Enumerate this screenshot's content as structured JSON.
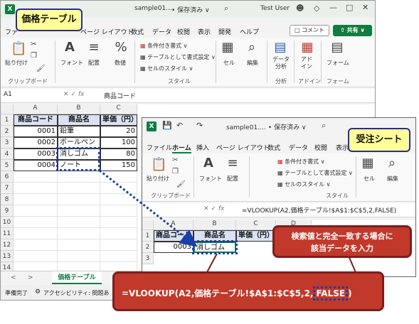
{
  "back_window": {
    "app_letter": "X",
    "file_name": "sample01.…",
    "save_status": "• 保存済み ∨",
    "search_icon": "⌕",
    "user": "Test User",
    "menu": [
      "ファ",
      "ページ レイアウト",
      "数式",
      "データ",
      "校閲",
      "表示",
      "開発",
      "ヘルプ"
    ],
    "comment_btn": "コメント",
    "share_btn": "共有",
    "ribbon": {
      "paste": "貼り付け",
      "font": "フォント",
      "align": "配置",
      "number": "数値",
      "cond_format": "条件付き書式 ∨",
      "table_format": "テーブルとして書式設定 ∨",
      "cell_style": "セルのスタイル ∨",
      "style_group": "スタイル",
      "cells": "セル",
      "edit": "編集",
      "data_analysis": "データ\n分析",
      "addin": "アド\nイン",
      "form": "フォーム",
      "clipboard_group": "クリップボード",
      "analysis_group": "分析",
      "addin_group": "アドイン",
      "form_group": "フォーム"
    },
    "name_box": "A1",
    "formula": "商品コード",
    "col_headers": [
      "A",
      "B",
      "C"
    ],
    "row_headers": [
      "1",
      "2",
      "3",
      "4",
      "5",
      "6",
      "7",
      "8",
      "9",
      "10",
      "11",
      "12",
      "13",
      "14",
      "15"
    ],
    "table": {
      "headers": [
        "商品コード",
        "商品名",
        "単価（円）"
      ],
      "rows": [
        [
          "0001",
          "鉛筆",
          "20"
        ],
        [
          "0002",
          "ボールペン",
          "100"
        ],
        [
          "0003",
          "消しゴム",
          "80"
        ],
        [
          "0004",
          "ノート",
          "150"
        ]
      ]
    },
    "sheet_tab": "価格テーブル",
    "status_left": "準備完了",
    "status_access": "アクセシビリティ: 問題あ"
  },
  "front_window": {
    "file_name": "sample01.… • 保存済み ∨",
    "menu": [
      "ファイル",
      "ホーム",
      "挿入",
      "ページ レイアウト",
      "数式",
      "データ",
      "校閲",
      "表示"
    ],
    "active_menu": "ホーム",
    "ribbon": {
      "paste": "貼り付け",
      "font": "フォント",
      "align": "配置",
      "cond_format": "条件付き書式 ∨",
      "table_format": "テーブルとして書式設定 ∨",
      "cell_style": "セルのスタイル ∨",
      "style_group": "スタイル",
      "cells": "セル",
      "edit": "編集",
      "clipboard_group": "クリップボード"
    },
    "formula": "=VLOOKUP(A2,価格テーブル!$A$1:$C$5,2,FALSE)",
    "col_headers": [
      "A",
      "B",
      "C",
      "D"
    ],
    "row_headers": [
      "1",
      "2",
      "3"
    ],
    "table": {
      "headers": [
        "商品コード",
        "商品名",
        "単価（円）"
      ],
      "row": [
        "0003",
        "消しゴム"
      ]
    }
  },
  "callouts": {
    "price_table": "価格テーブル",
    "order_sheet": "受注シート",
    "note": "検索値と完全一致する場合に\n該当データを入力",
    "formula_big_prefix": "=VLOOKUP(A2,価格テーブル!$A$1:$C$5,2,",
    "formula_big_false": "FALSE",
    "formula_big_suffix": ")"
  },
  "colors": {
    "excel_green": "#107c41",
    "callout_yellow": "#ffff99",
    "callout_red": "#c0392b",
    "dotted_blue": "#1a3fa8",
    "header_fill": "#d9e1f2"
  }
}
